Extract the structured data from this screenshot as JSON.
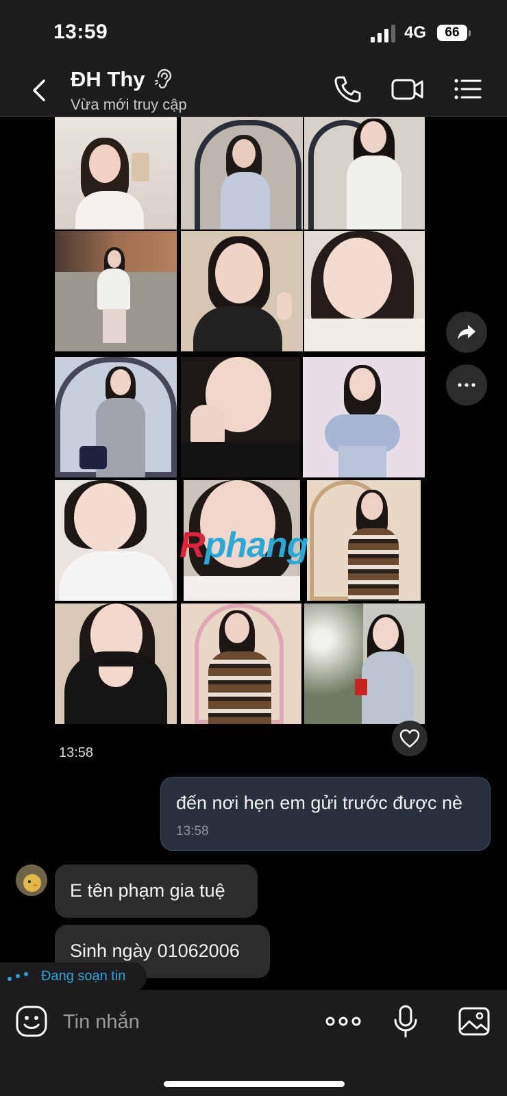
{
  "status_bar": {
    "time": "13:59",
    "network": "4G",
    "battery": "66"
  },
  "header": {
    "contact_name": "ĐH Thy",
    "status": "Vừa mới truy cập"
  },
  "photo_grid": {
    "timestamp": "13:58",
    "watermark": "phang",
    "watermark_prefix": "R"
  },
  "messages": [
    {
      "direction": "out",
      "text": "đến nơi hẹn em gửi trước được nè",
      "time": "13:58"
    },
    {
      "direction": "in",
      "text": "E tên phạm gia tuệ"
    },
    {
      "direction": "in",
      "text": "Sinh ngày 01062006"
    }
  ],
  "typing_indicator": "Đang soạn tin",
  "composer": {
    "placeholder": "Tin nhắn"
  },
  "colors": {
    "accent": "#2aa5d6",
    "outgoing_bubble": "#27303b",
    "incoming_bubble": "#2c2c2e",
    "watermark_red": "#e0233a"
  }
}
